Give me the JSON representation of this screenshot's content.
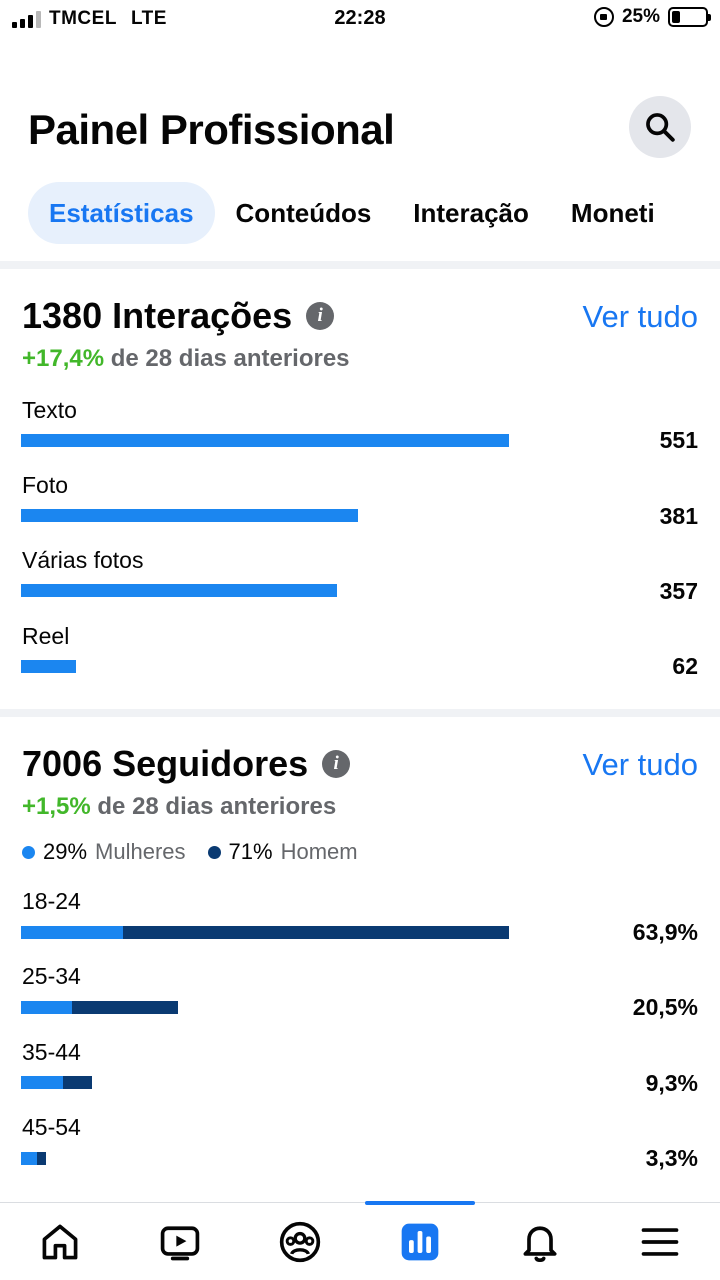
{
  "status_bar": {
    "carrier": "TMCEL",
    "network": "LTE",
    "time": "22:28",
    "battery": "25%",
    "battery_level": 0.25
  },
  "header": {
    "title": "Painel Profissional",
    "search_icon": "search-icon"
  },
  "tabs": [
    {
      "label": "Estatísticas",
      "active": true
    },
    {
      "label": "Conteúdos",
      "active": false
    },
    {
      "label": "Interação",
      "active": false
    },
    {
      "label": "Moneti",
      "active": false
    }
  ],
  "interactions": {
    "title": "1380 Interações",
    "see_all": "Ver tudo",
    "change": "+17,4%",
    "change_suffix": "de 28 dias anteriores",
    "items": [
      {
        "label": "Texto",
        "value": "551",
        "amount": 551
      },
      {
        "label": "Foto",
        "value": "381",
        "amount": 381
      },
      {
        "label": "Várias fotos",
        "value": "357",
        "amount": 357
      },
      {
        "label": "Reel",
        "value": "62",
        "amount": 62
      }
    ]
  },
  "followers": {
    "title": "7006 Seguidores",
    "see_all": "Ver tudo",
    "change": "+1,5%",
    "change_suffix": "de 28 dias anteriores",
    "legend": [
      {
        "pct": "29%",
        "label": "Mulheres",
        "color": "#1b86f0"
      },
      {
        "pct": "71%",
        "label": "Homem",
        "color": "#0a3a72"
      }
    ],
    "age_groups": [
      {
        "label": "18-24",
        "value": "63,9%",
        "total": 63.9,
        "women": 13.3
      },
      {
        "label": "25-34",
        "value": "20,5%",
        "total": 20.5,
        "women": 6.7
      },
      {
        "label": "35-44",
        "value": "9,3%",
        "total": 9.3,
        "women": 5.5
      },
      {
        "label": "45-54",
        "value": "3,3%",
        "total": 3.3,
        "women": 2.1
      }
    ]
  },
  "colors": {
    "accent": "#1877f2",
    "bar_primary": "#1b86f0",
    "bar_dark": "#0a3a72",
    "positive": "#42b72a",
    "muted": "#65676b"
  },
  "bottom_nav": [
    {
      "icon": "home-icon",
      "active": false
    },
    {
      "icon": "video-icon",
      "active": false
    },
    {
      "icon": "groups-icon",
      "active": false
    },
    {
      "icon": "dashboard-icon",
      "active": true
    },
    {
      "icon": "bell-icon",
      "active": false
    },
    {
      "icon": "menu-icon",
      "active": false
    }
  ]
}
